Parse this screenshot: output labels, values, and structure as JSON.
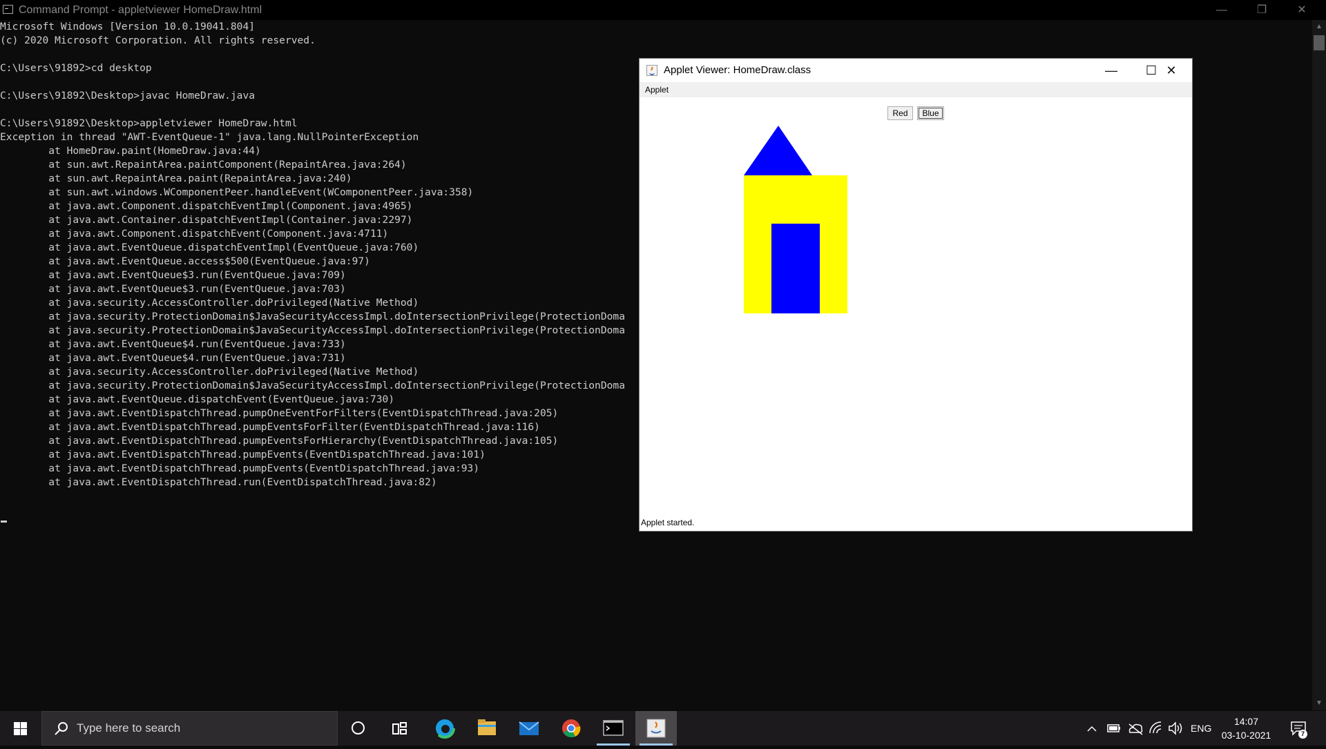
{
  "cmd": {
    "title": "Command Prompt - appletviewer  HomeDraw.html",
    "controls": {
      "minimize": "—",
      "restore": "❐",
      "close": "✕"
    },
    "lines": [
      "Microsoft Windows [Version 10.0.19041.804]",
      "(c) 2020 Microsoft Corporation. All rights reserved.",
      "",
      "C:\\Users\\91892>cd desktop",
      "",
      "C:\\Users\\91892\\Desktop>javac HomeDraw.java",
      "",
      "C:\\Users\\91892\\Desktop>appletviewer HomeDraw.html",
      "Exception in thread \"AWT-EventQueue-1\" java.lang.NullPointerException",
      "        at HomeDraw.paint(HomeDraw.java:44)",
      "        at sun.awt.RepaintArea.paintComponent(RepaintArea.java:264)",
      "        at sun.awt.RepaintArea.paint(RepaintArea.java:240)",
      "        at sun.awt.windows.WComponentPeer.handleEvent(WComponentPeer.java:358)",
      "        at java.awt.Component.dispatchEventImpl(Component.java:4965)",
      "        at java.awt.Container.dispatchEventImpl(Container.java:2297)",
      "        at java.awt.Component.dispatchEvent(Component.java:4711)",
      "        at java.awt.EventQueue.dispatchEventImpl(EventQueue.java:760)",
      "        at java.awt.EventQueue.access$500(EventQueue.java:97)",
      "        at java.awt.EventQueue$3.run(EventQueue.java:709)",
      "        at java.awt.EventQueue$3.run(EventQueue.java:703)",
      "        at java.security.AccessController.doPrivileged(Native Method)",
      "        at java.security.ProtectionDomain$JavaSecurityAccessImpl.doIntersectionPrivilege(ProtectionDoma",
      "        at java.security.ProtectionDomain$JavaSecurityAccessImpl.doIntersectionPrivilege(ProtectionDoma",
      "        at java.awt.EventQueue$4.run(EventQueue.java:733)",
      "        at java.awt.EventQueue$4.run(EventQueue.java:731)",
      "        at java.security.AccessController.doPrivileged(Native Method)",
      "        at java.security.ProtectionDomain$JavaSecurityAccessImpl.doIntersectionPrivilege(ProtectionDoma",
      "        at java.awt.EventQueue.dispatchEvent(EventQueue.java:730)",
      "        at java.awt.EventDispatchThread.pumpOneEventForFilters(EventDispatchThread.java:205)",
      "        at java.awt.EventDispatchThread.pumpEventsForFilter(EventDispatchThread.java:116)",
      "        at java.awt.EventDispatchThread.pumpEventsForHierarchy(EventDispatchThread.java:105)",
      "        at java.awt.EventDispatchThread.pumpEvents(EventDispatchThread.java:101)",
      "        at java.awt.EventDispatchThread.pumpEvents(EventDispatchThread.java:93)",
      "        at java.awt.EventDispatchThread.run(EventDispatchThread.java:82)"
    ]
  },
  "applet": {
    "title": "Applet Viewer: HomeDraw.class",
    "menu": "Applet",
    "buttons": {
      "red": "Red",
      "blue": "Blue"
    },
    "status": "Applet started.",
    "controls": {
      "minimize": "—",
      "maximize": "☐",
      "close": "✕"
    },
    "colors": {
      "roof": "#0000ff",
      "wall": "#ffff00",
      "door": "#0000ff"
    }
  },
  "taskbar": {
    "search_placeholder": "Type here to search",
    "language": "ENG",
    "time": "14:07",
    "date": "03-10-2021",
    "notification_count": "7",
    "pinned_icons": [
      "edge-icon",
      "file-explorer-icon",
      "mail-icon",
      "chrome-icon",
      "command-prompt-icon",
      "java-icon"
    ]
  }
}
